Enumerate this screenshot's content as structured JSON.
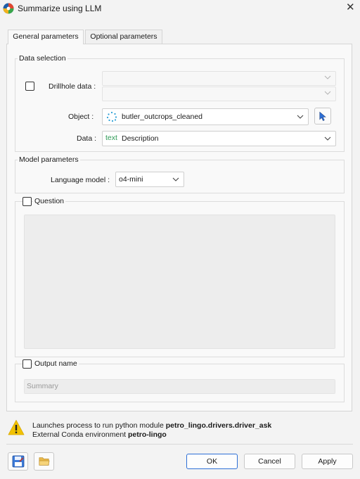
{
  "window": {
    "title": "Summarize using LLM",
    "close_glyph": "✕"
  },
  "tabs": [
    {
      "label": "General parameters",
      "active": true
    },
    {
      "label": "Optional parameters",
      "active": false
    }
  ],
  "data_selection": {
    "title": "Data selection",
    "drillhole_label": "Drillhole data :",
    "drillhole_checked": false,
    "object_label": "Object :",
    "object_value": "butler_outcrops_cleaned",
    "object_icon": "point-cloud-icon",
    "data_label": "Data :",
    "data_type_tag": "text",
    "data_value": "Description"
  },
  "model_parameters": {
    "title": "Model parameters",
    "language_model_label": "Language model :",
    "language_model_value": "o4-mini"
  },
  "question": {
    "label": "Question",
    "checked": false
  },
  "output_name": {
    "label": "Output name",
    "checked": false,
    "placeholder": "Summary"
  },
  "footer": {
    "line1_prefix": "Launches process to run python module ",
    "line1_module": "petro_lingo.drivers.driver_ask",
    "line2_prefix": "External Conda environment ",
    "line2_env": "petro-lingo"
  },
  "buttons": {
    "ok": "OK",
    "cancel": "Cancel",
    "apply": "Apply"
  },
  "colors": {
    "accent": "#2d6fd6",
    "text_tag": "#2e9a55",
    "warning": "#f2c200"
  }
}
